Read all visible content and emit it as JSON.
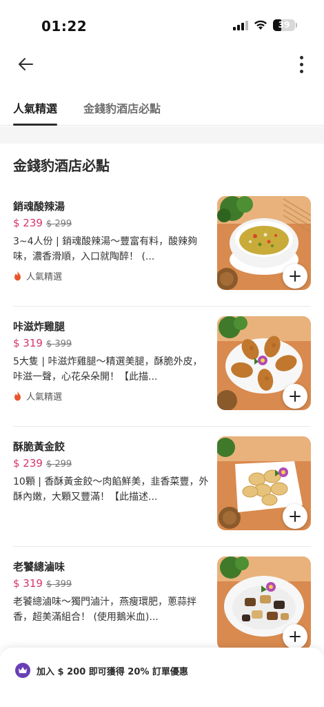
{
  "status_bar": {
    "time": "01:22",
    "battery": "39"
  },
  "tabs": [
    {
      "label": "人氣精選",
      "active": true
    },
    {
      "label": "金錢豹酒店必點",
      "active": false
    }
  ],
  "section": {
    "title": "金錢豹酒店必點"
  },
  "items": [
    {
      "name": "銷魂酸辣湯",
      "price": "$ 239",
      "original_price": "$ 299",
      "description": "3~4人份 | 銷魂酸辣湯～豐富有料，酸辣夠味，濃香滑順，入口就陶醉！ (...",
      "tag": "人氣精選",
      "image": "hot-and-sour-soup"
    },
    {
      "name": "咔滋炸雞腿",
      "price": "$ 319",
      "original_price": "$ 399",
      "description": "5大隻 | 咔滋炸雞腿～精選美腿，酥脆外皮，咔滋一聲，心花朵朵開！【此描...",
      "tag": "人氣精選",
      "image": "fried-chicken-drumsticks"
    },
    {
      "name": "酥脆黃金餃",
      "price": "$ 239",
      "original_price": "$ 299",
      "description": "10顆 | 香酥黃金餃～肉餡鮮美，韭香菜豐，外酥內嫩，大顆又豐滿！【此描述...",
      "tag": "",
      "image": "golden-dumplings"
    },
    {
      "name": "老饕總滷味",
      "price": "$ 319",
      "original_price": "$ 399",
      "description": "老饕總滷味～獨門滷汁，燕瘦環肥，蔥蒜拌香，超美滿組合！ (使用鵝米血)...",
      "tag": "",
      "image": "braised-platter"
    }
  ],
  "banner": {
    "text": "加入 $ 200 即可獲得 20% 訂單優惠"
  },
  "colors": {
    "price": "#d6336c",
    "banner_icon": "#6a3fb5",
    "flame": "#e8542b"
  }
}
